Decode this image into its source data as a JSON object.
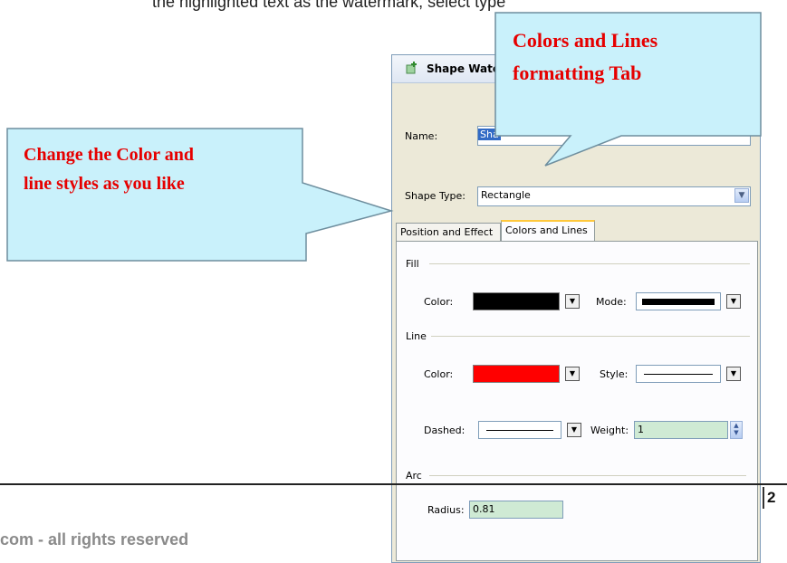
{
  "slide": {
    "top_text": "the highlighted text as the watermark, select type",
    "footer_text": "com - all rights reserved",
    "page_number": "2"
  },
  "dialog": {
    "title": "Shape Watermark",
    "name_label": "Name:",
    "name_value": "Sha",
    "shape_type_label": "Shape Type:",
    "shape_type_value": "Rectangle",
    "tabs": [
      {
        "label": "Position and Effect",
        "active": false
      },
      {
        "label": "Colors and Lines",
        "active": true
      }
    ],
    "fill": {
      "group_label": "Fill",
      "color_label": "Color:",
      "color_value": "#000000",
      "mode_label": "Mode:",
      "mode_value": "#000000"
    },
    "line": {
      "group_label": "Line",
      "color_label": "Color:",
      "color_value": "#ff0000",
      "style_label": "Style:",
      "dashed_label": "Dashed:",
      "weight_label": "Weight:",
      "weight_value": "1"
    },
    "arc": {
      "group_label": "Arc",
      "radius_label": "Radius:",
      "radius_value": "0.81"
    }
  },
  "callouts": {
    "tab_callout": "Colors and Lines formatting Tab",
    "tab_callout_line1": "Colors and Lines",
    "tab_callout_line2": "formatting Tab",
    "left_callout_line1": "Change the Color and",
    "left_callout_line2": "line styles as you like"
  },
  "colors": {
    "callout_fill": "#c9f1fb",
    "callout_text": "#e60000",
    "active_tab_accent": "#ffc83c"
  }
}
